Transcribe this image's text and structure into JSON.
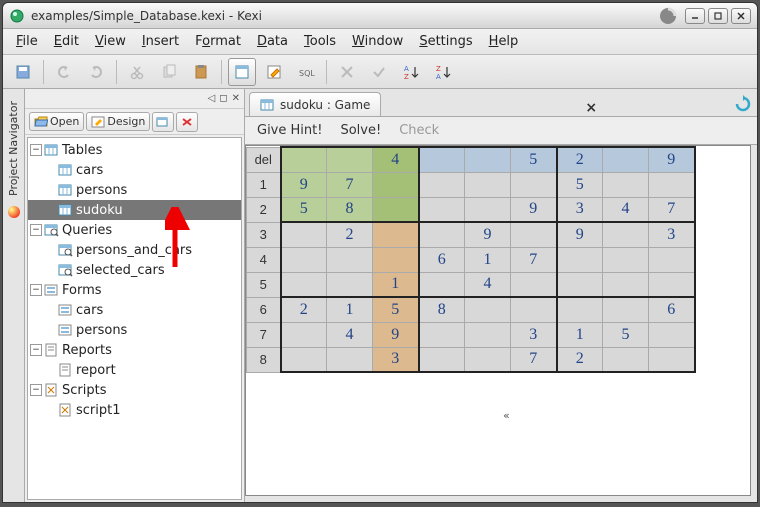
{
  "window": {
    "title": "examples/Simple_Database.kexi - Kexi"
  },
  "menu": {
    "file": "File",
    "edit": "Edit",
    "view": "View",
    "insert": "Insert",
    "format": "Format",
    "data": "Data",
    "tools": "Tools",
    "window": "Window",
    "settings": "Settings",
    "help": "Help"
  },
  "navigator": {
    "title": "Project Navigator",
    "open": "Open",
    "design": "Design",
    "groups": [
      {
        "label": "Tables",
        "items": [
          "cars",
          "persons",
          "sudoku"
        ],
        "selected": 2
      },
      {
        "label": "Queries",
        "items": [
          "persons_and_cars",
          "selected_cars"
        ]
      },
      {
        "label": "Forms",
        "items": [
          "cars",
          "persons"
        ]
      },
      {
        "label": "Reports",
        "items": [
          "report"
        ]
      },
      {
        "label": "Scripts",
        "items": [
          "script1"
        ]
      }
    ]
  },
  "tab": {
    "label": "sudoku : Game"
  },
  "game": {
    "hint": "Give Hint!",
    "solve": "Solve!",
    "check": "Check"
  },
  "sudoku": {
    "hdr": "del",
    "rows": [
      "1",
      "2",
      "3",
      "4",
      "5",
      "6",
      "7",
      "8"
    ],
    "grid": [
      [
        "",
        "",
        "4",
        "",
        "",
        "5",
        "2",
        "",
        "9"
      ],
      [
        "9",
        "7",
        "",
        "",
        "",
        "",
        "5",
        "",
        ""
      ],
      [
        "5",
        "8",
        "",
        "",
        "",
        "9",
        "3",
        "4",
        "7"
      ],
      [
        "",
        "2",
        "",
        "",
        "9",
        "",
        "9",
        "",
        "3"
      ],
      [
        "",
        "",
        "",
        "6",
        "1",
        "7",
        "",
        "",
        ""
      ],
      [
        "",
        "",
        "1",
        "",
        "4",
        "",
        "",
        "",
        ""
      ],
      [
        "2",
        "1",
        "5",
        "8",
        "",
        "",
        "",
        "",
        "6"
      ],
      [
        "",
        "4",
        "9",
        "",
        "",
        "3",
        "1",
        "5",
        ""
      ],
      [
        "",
        "",
        "3",
        "",
        "",
        "7",
        "2",
        "",
        ""
      ]
    ]
  }
}
